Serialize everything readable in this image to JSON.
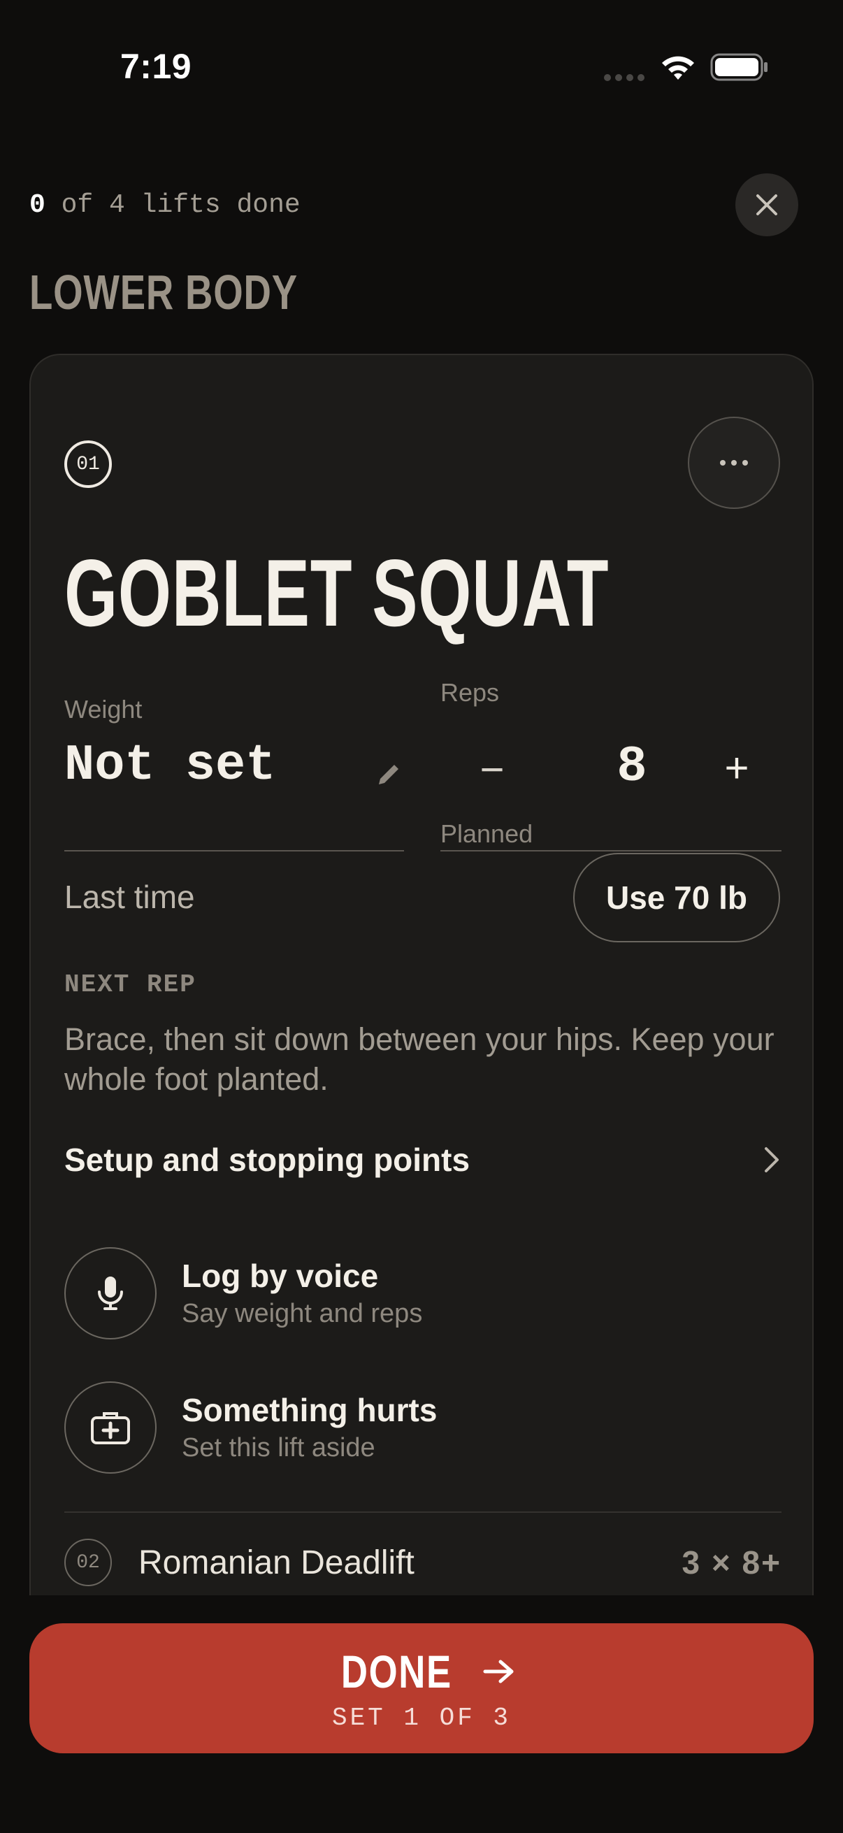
{
  "status_bar": {
    "time": "7:19"
  },
  "header": {
    "progress_done": "0",
    "progress_rest": " of 4 lifts done",
    "section_title": "LOWER BODY"
  },
  "current_exercise": {
    "number": "01",
    "name": "GOBLET SQUAT",
    "weight_label": "Weight",
    "weight_value": "Not set",
    "reps_label": "Reps",
    "reps_minus": "−",
    "reps_value": "8",
    "reps_plus": "+",
    "reps_sublabel": "Planned",
    "last_time_label": "Last time",
    "use_last_button": "Use 70 lb",
    "next_rep_label": "NEXT REP",
    "next_rep_text": "Brace, then sit down between your hips. Keep your whole foot planted.",
    "setup_link": "Setup and stopping points"
  },
  "actions": [
    {
      "title": "Log by voice",
      "subtitle": "Say weight and reps",
      "icon": "microphone-icon"
    },
    {
      "title": "Something hurts",
      "subtitle": "Set this lift aside",
      "icon": "first-aid-kit-icon"
    }
  ],
  "next_exercise": {
    "number": "02",
    "name": "Romanian Deadlift",
    "scheme": "3 × 8+"
  },
  "done_button": {
    "label": "DONE",
    "sublabel": "SET 1 OF 3"
  },
  "colors": {
    "accent": "#b83c2e",
    "background": "#0e0d0c",
    "card": "#1c1b19"
  }
}
